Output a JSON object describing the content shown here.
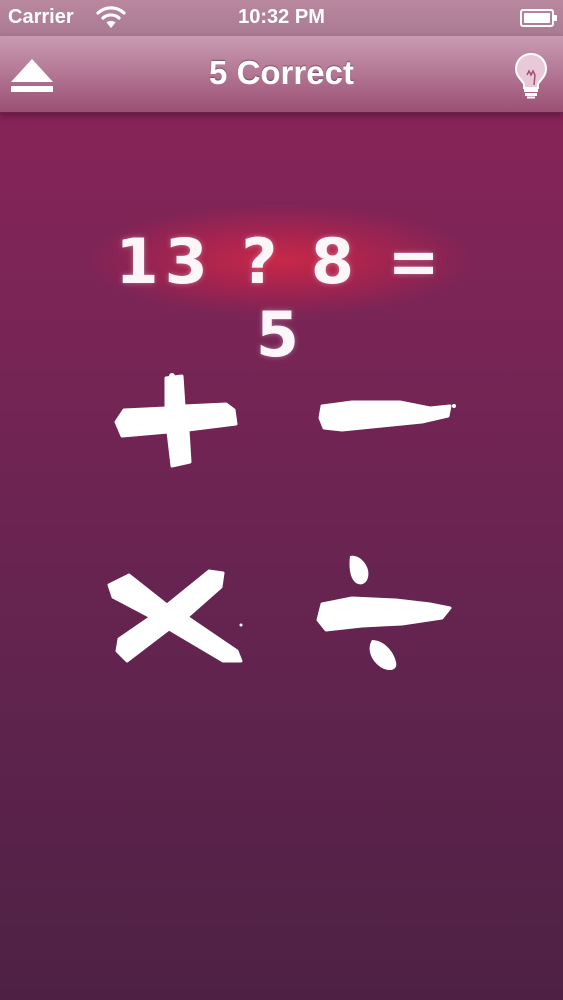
{
  "status_bar": {
    "carrier": "Carrier",
    "time": "10:32 PM",
    "wifi_icon": "wifi-icon",
    "battery_icon": "battery-icon",
    "battery_level": 1.0
  },
  "nav_bar": {
    "title": "5 Correct",
    "left_icon": "eject-icon",
    "right_icon": "lightbulb-icon"
  },
  "equation": {
    "text": "13 ? 8 = 5"
  },
  "operators": [
    {
      "symbol": "+",
      "icon": "plus-icon"
    },
    {
      "symbol": "−",
      "icon": "minus-icon"
    },
    {
      "symbol": "×",
      "icon": "times-icon"
    },
    {
      "symbol": "÷",
      "icon": "divide-icon"
    }
  ],
  "colors": {
    "background_top": "#8e2358",
    "background_bottom": "#4e2144",
    "nav_bar": "#b57a97",
    "equation_glow": "#d62846",
    "chalk": "#ffffff"
  }
}
